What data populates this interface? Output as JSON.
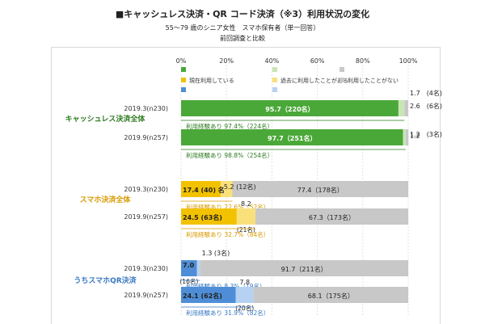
{
  "title": "■キャッシュレス決済・QR コード決済（※3）利用状況の変化",
  "subtitle": "55～79 歳のシニア女性　スマホ保有者（単一回答）",
  "note": "前回調査と比較",
  "chart_data": {
    "type": "bar",
    "orientation": "horizontal",
    "stacked": true,
    "xlim": [
      0,
      100
    ],
    "x_ticks": [
      "0%",
      "20%",
      "40%",
      "60%",
      "80%",
      "100%"
    ],
    "grid": true,
    "legend_position": "top",
    "legend": [
      {
        "name": "現在利用している",
        "color": "#f2c200"
      },
      {
        "name": "過去に利用したことがある",
        "color": "#f9e07a"
      },
      {
        "name": "利用したことがない",
        "color": "#c8c8c8"
      }
    ],
    "groups": [
      {
        "name": "キャッシュレス決済全体",
        "rows": [
          {
            "period": "2019.3(n230)",
            "values": [
              95.7,
              2.6,
              1.7
            ],
            "labels": [
              "95.7（220名）",
              "2.6　(6名)",
              "1.7　(4名)"
            ],
            "experienced": "利用経験あり 97.4%（224名）"
          },
          {
            "period": "2019.9(n257)",
            "values": [
              97.7,
              1.2,
              1.2
            ],
            "labels": [
              "97.7（251名）",
              "1.2",
              "1.2　(3名)"
            ],
            "experienced": "利用経験あり 98.8%（254名）"
          }
        ]
      },
      {
        "name": "スマホ決済全体",
        "rows": [
          {
            "period": "2019.3(n230)",
            "values": [
              17.4,
              5.2,
              77.4
            ],
            "labels": [
              "17.4 (40) 名",
              "5.2 (12名)",
              "77.4（178名）"
            ],
            "experienced": "利用経験あり 22.6%（52名）"
          },
          {
            "period": "2019.9(n257)",
            "values": [
              24.5,
              8.2,
              67.3
            ],
            "labels": [
              "24.5 (63名)",
              "8.2",
              "67.3（173名）"
            ],
            "sub_label": "(21名)",
            "experienced": "利用経験あり 32.7%（84名）"
          }
        ]
      },
      {
        "name": "うちスマホQR決済",
        "rows": [
          {
            "period": "2019.3(n230)",
            "values": [
              7.0,
              1.3,
              91.7
            ],
            "labels": [
              "7.0",
              "1.3 (3名)",
              "91.7（211名）"
            ],
            "sub_label": "(16名)",
            "experienced": "利用経験あり 8.3%（19名）"
          },
          {
            "period": "2019.9(n257)",
            "values": [
              24.1,
              7.8,
              68.1
            ],
            "labels": [
              "24.1 (62名)",
              "7.8",
              "68.1（175名）"
            ],
            "sub_label": "(20名)",
            "experienced": "利用経験あり 31.9%（82名）"
          }
        ]
      }
    ],
    "group_colors": [
      {
        "current": "#4aa838",
        "past": "#c8e6b4",
        "never": "#c8c8c8",
        "text": "#2d7a1f"
      },
      {
        "current": "#f2c200",
        "past": "#f9e07a",
        "never": "#c8c8c8",
        "text": "#d99a00"
      },
      {
        "current": "#4f8ed6",
        "past": "#b6d2f2",
        "never": "#c8c8c8",
        "text": "#3a78c2"
      }
    ]
  }
}
